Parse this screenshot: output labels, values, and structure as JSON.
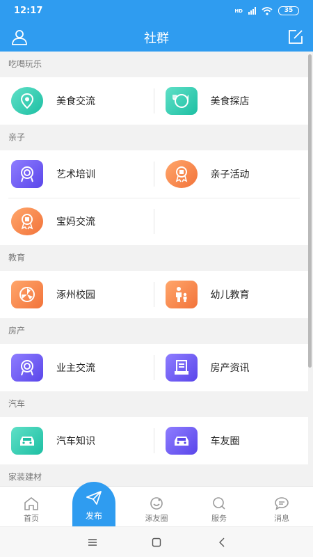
{
  "status_bar": {
    "time": "12:17",
    "network": "HD",
    "battery": "35"
  },
  "header": {
    "title": "社群",
    "left_icon": "user-icon",
    "right_icon": "edit-icon"
  },
  "sections": [
    {
      "label": "吃喝玩乐",
      "rows": [
        [
          {
            "label": "美食交流",
            "icon": "location-pin-icon",
            "color": "#1dbfa3"
          },
          {
            "label": "美食探店",
            "icon": "dining-icon",
            "color": "#1dbfa3"
          }
        ]
      ]
    },
    {
      "label": "亲子",
      "rows": [
        [
          {
            "label": "艺术培训",
            "icon": "badge-icon",
            "color": "#5a46ea"
          },
          {
            "label": "亲子活动",
            "icon": "medal-icon",
            "color": "#f2733a"
          }
        ],
        [
          {
            "label": "宝妈交流",
            "icon": "medal-icon",
            "color": "#f2733a"
          }
        ]
      ]
    },
    {
      "label": "教育",
      "rows": [
        [
          {
            "label": "涿州校园",
            "icon": "pinwheel-icon",
            "color": "#f2733a"
          },
          {
            "label": "幼儿教育",
            "icon": "parent-child-icon",
            "color": "#f2733a"
          }
        ]
      ]
    },
    {
      "label": "房产",
      "rows": [
        [
          {
            "label": "业主交流",
            "icon": "badge-icon",
            "color": "#5a46ea"
          },
          {
            "label": "房产资讯",
            "icon": "news-icon",
            "color": "#5a46ea"
          }
        ]
      ]
    },
    {
      "label": "汽车",
      "rows": [
        [
          {
            "label": "汽车知识",
            "icon": "car-icon",
            "color": "#1dbfa3"
          },
          {
            "label": "车友圈",
            "icon": "car-icon",
            "color": "#5a46ea"
          }
        ]
      ]
    },
    {
      "label": "家装建材",
      "rows": []
    }
  ],
  "tabbar": {
    "home": "首页",
    "publish": "发布",
    "circle": "涿友圈",
    "service": "服务",
    "message": "消息"
  },
  "colors": {
    "primary": "#2f9cf0",
    "teal": "#1dbfa3",
    "purple": "#5a46ea",
    "orange": "#f2733a"
  }
}
